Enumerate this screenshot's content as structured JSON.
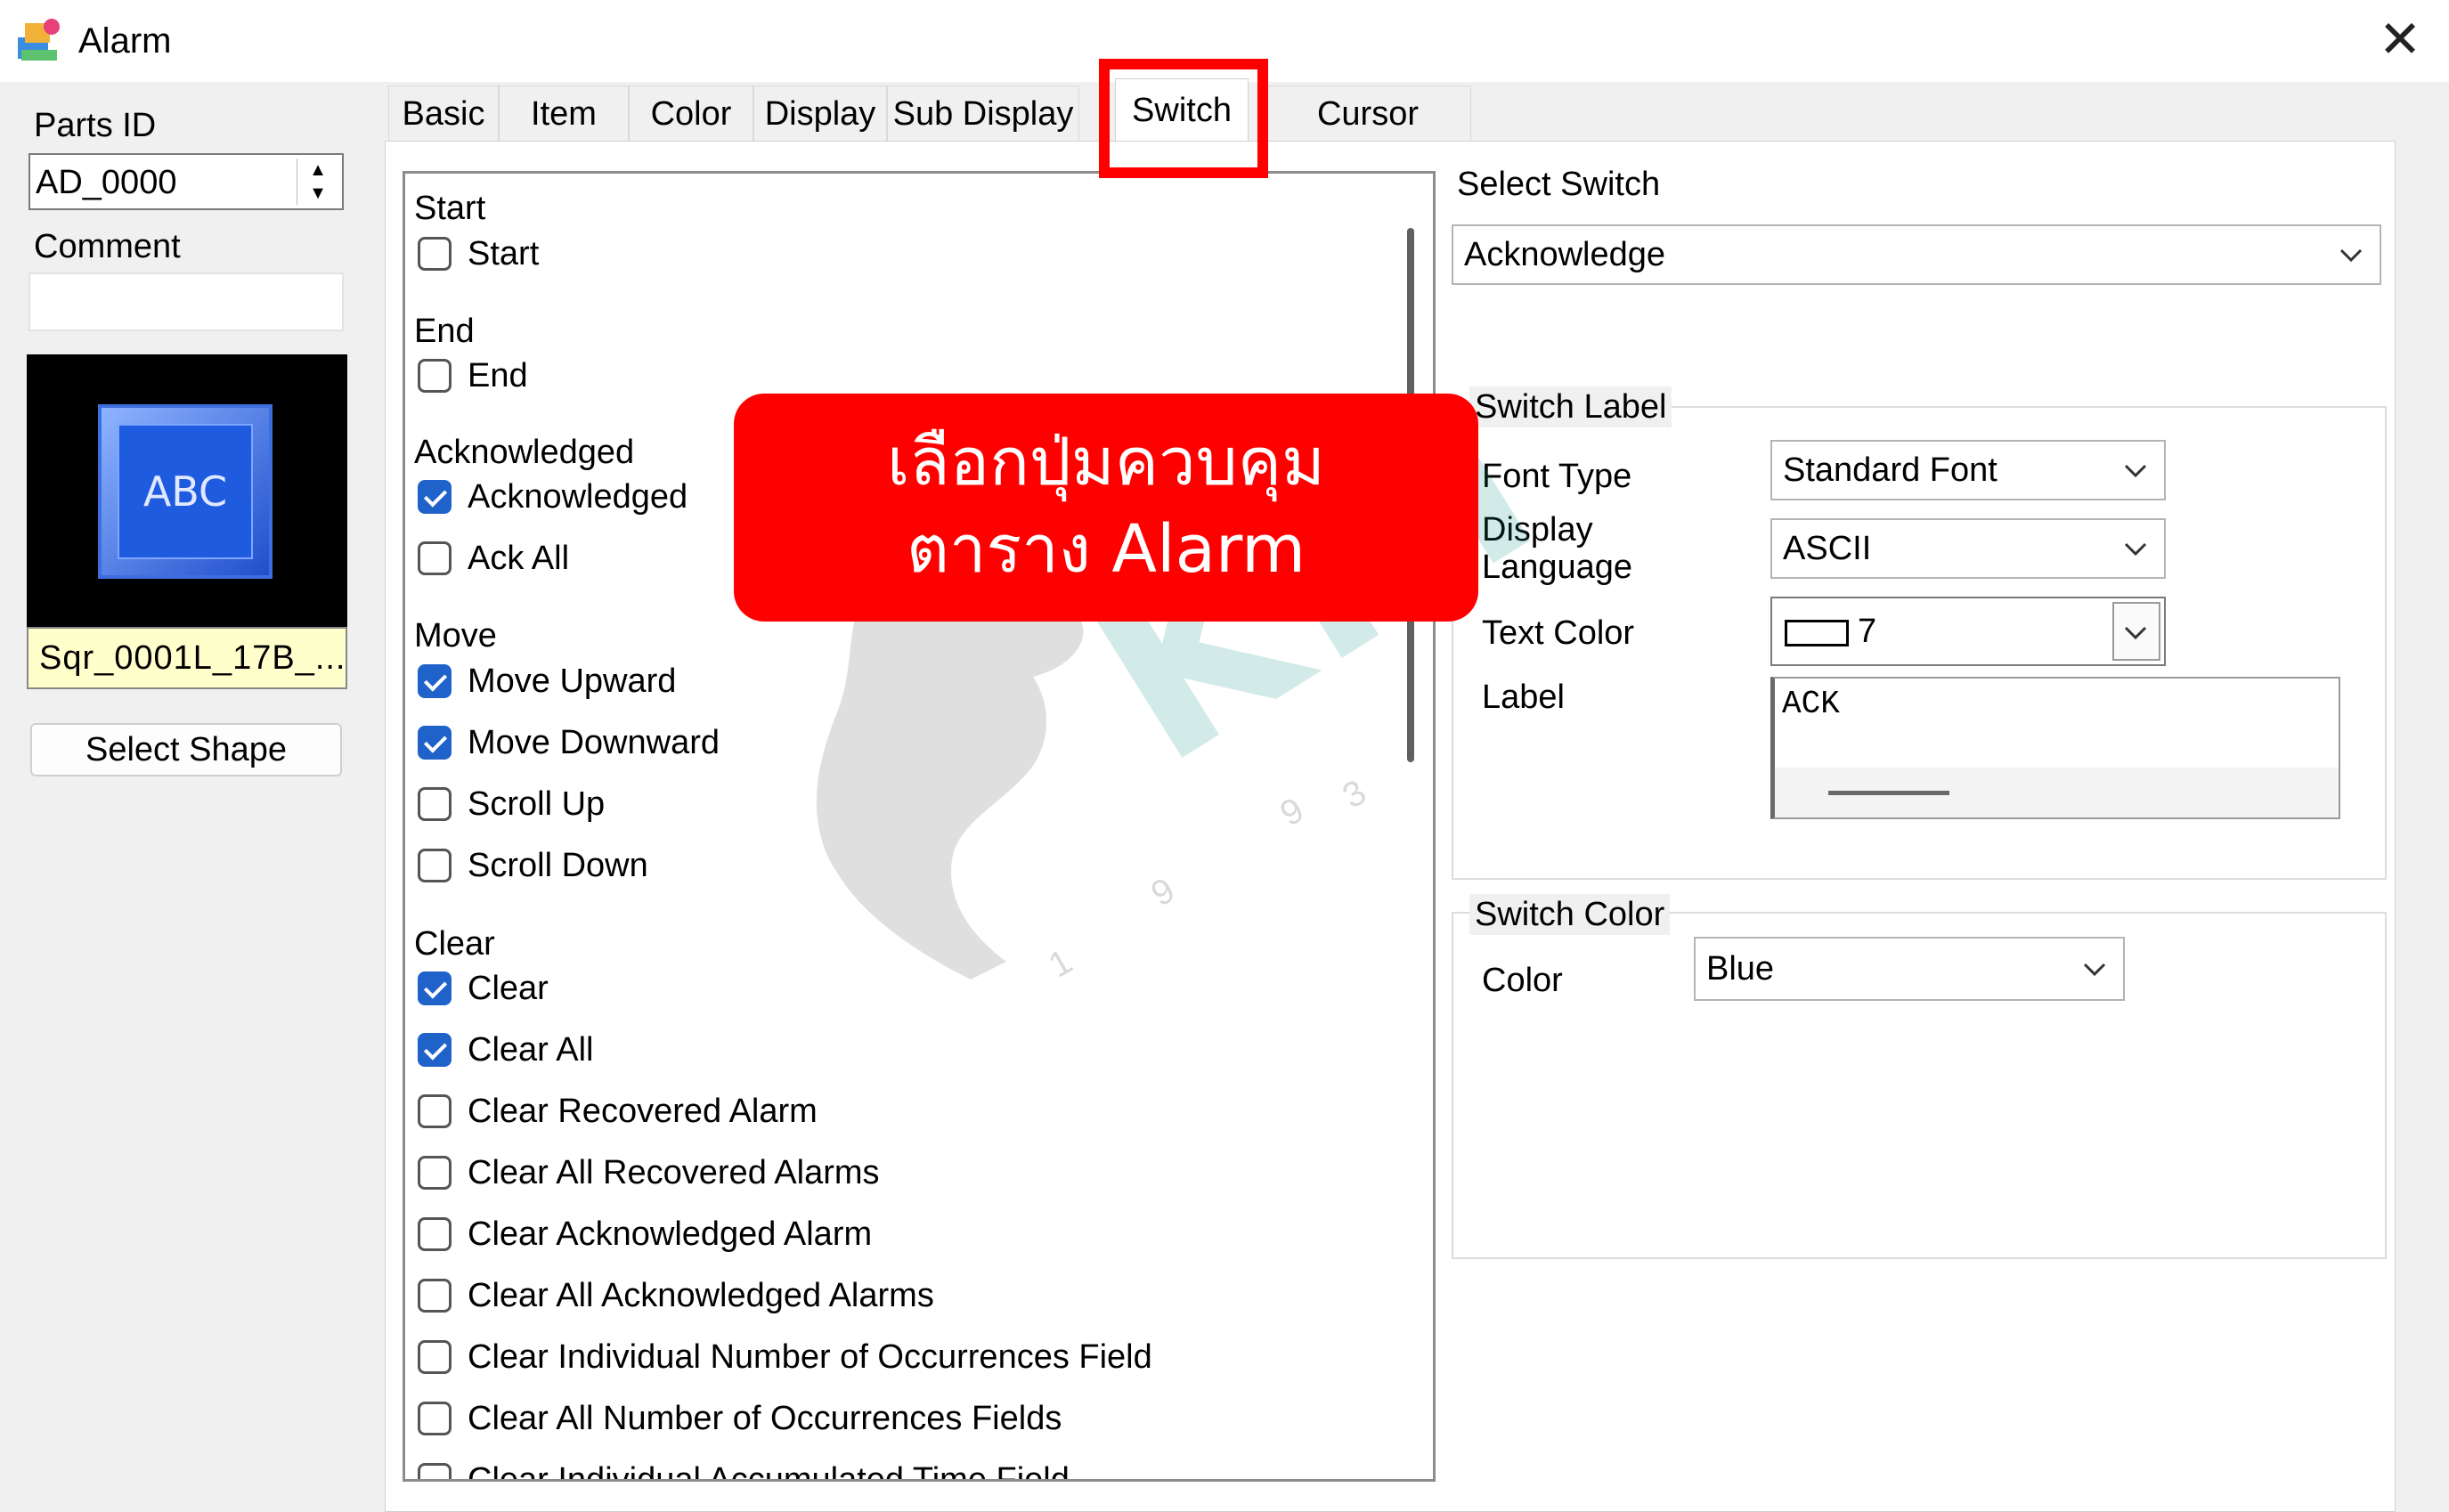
{
  "window": {
    "title": "Alarm",
    "close_glyph": "✕"
  },
  "left": {
    "parts_id_label": "Parts ID",
    "parts_id_value": "AD_0000",
    "comment_label": "Comment",
    "comment_value": "",
    "preview_text": "ABC",
    "shape_name": "Sqr_0001L_17B_...",
    "select_shape": "Select Shape"
  },
  "tabs": [
    {
      "label": "Basic"
    },
    {
      "label": "Item"
    },
    {
      "label": "Color"
    },
    {
      "label": "Display"
    },
    {
      "label": "Sub Display"
    },
    {
      "label": "Switch",
      "active": true
    },
    {
      "label": "Cursor Shape"
    }
  ],
  "switch_groups": [
    {
      "title": "Start",
      "items": [
        {
          "label": "Start",
          "checked": false
        }
      ]
    },
    {
      "title": "End",
      "items": [
        {
          "label": "End",
          "checked": false
        }
      ]
    },
    {
      "title": "Acknowledged",
      "items": [
        {
          "label": "Acknowledged",
          "checked": true
        },
        {
          "label": "Ack All",
          "checked": false
        }
      ]
    },
    {
      "title": "Move",
      "items": [
        {
          "label": "Move Upward",
          "checked": true
        },
        {
          "label": "Move Downward",
          "checked": true
        },
        {
          "label": "Scroll Up",
          "checked": false
        },
        {
          "label": "Scroll Down",
          "checked": false
        }
      ]
    },
    {
      "title": "Clear",
      "items": [
        {
          "label": "Clear",
          "checked": true
        },
        {
          "label": "Clear All",
          "checked": true
        },
        {
          "label": "Clear Recovered Alarm",
          "checked": false
        },
        {
          "label": "Clear All Recovered Alarms",
          "checked": false
        },
        {
          "label": "Clear Acknowledged Alarm",
          "checked": false
        },
        {
          "label": "Clear All Acknowledged Alarms",
          "checked": false
        },
        {
          "label": "Clear Individual Number of Occurrences Field",
          "checked": false
        },
        {
          "label": "Clear All Number of Occurrences Fields",
          "checked": false
        },
        {
          "label": "Clear Individual Accumulated Time Field",
          "checked": false
        }
      ]
    }
  ],
  "right": {
    "select_switch_label": "Select Switch",
    "select_switch_value": "Acknowledge",
    "switch_label": {
      "legend": "Switch Label",
      "font_type_label": "Font Type",
      "font_type_value": "Standard Font",
      "display_language_label": "Display\nLanguage",
      "display_language_value": "ASCII",
      "text_color_label": "Text Color",
      "text_color_value": "7",
      "label_label": "Label",
      "label_value": "ACK"
    },
    "switch_color": {
      "legend": "Switch Color",
      "color_label": "Color",
      "color_value": "Blue"
    }
  },
  "annotation": {
    "line1": "เลือกปุ่มควบคุม",
    "line2": "ตาราง  Alarm"
  },
  "watermark": {
    "text": "KPI",
    "digits": [
      "1",
      "9",
      "9",
      "3"
    ]
  },
  "colors": {
    "highlight": "#ff0000",
    "checkbox_on": "#1f62c9",
    "preview_button": "#1f5bdf"
  }
}
